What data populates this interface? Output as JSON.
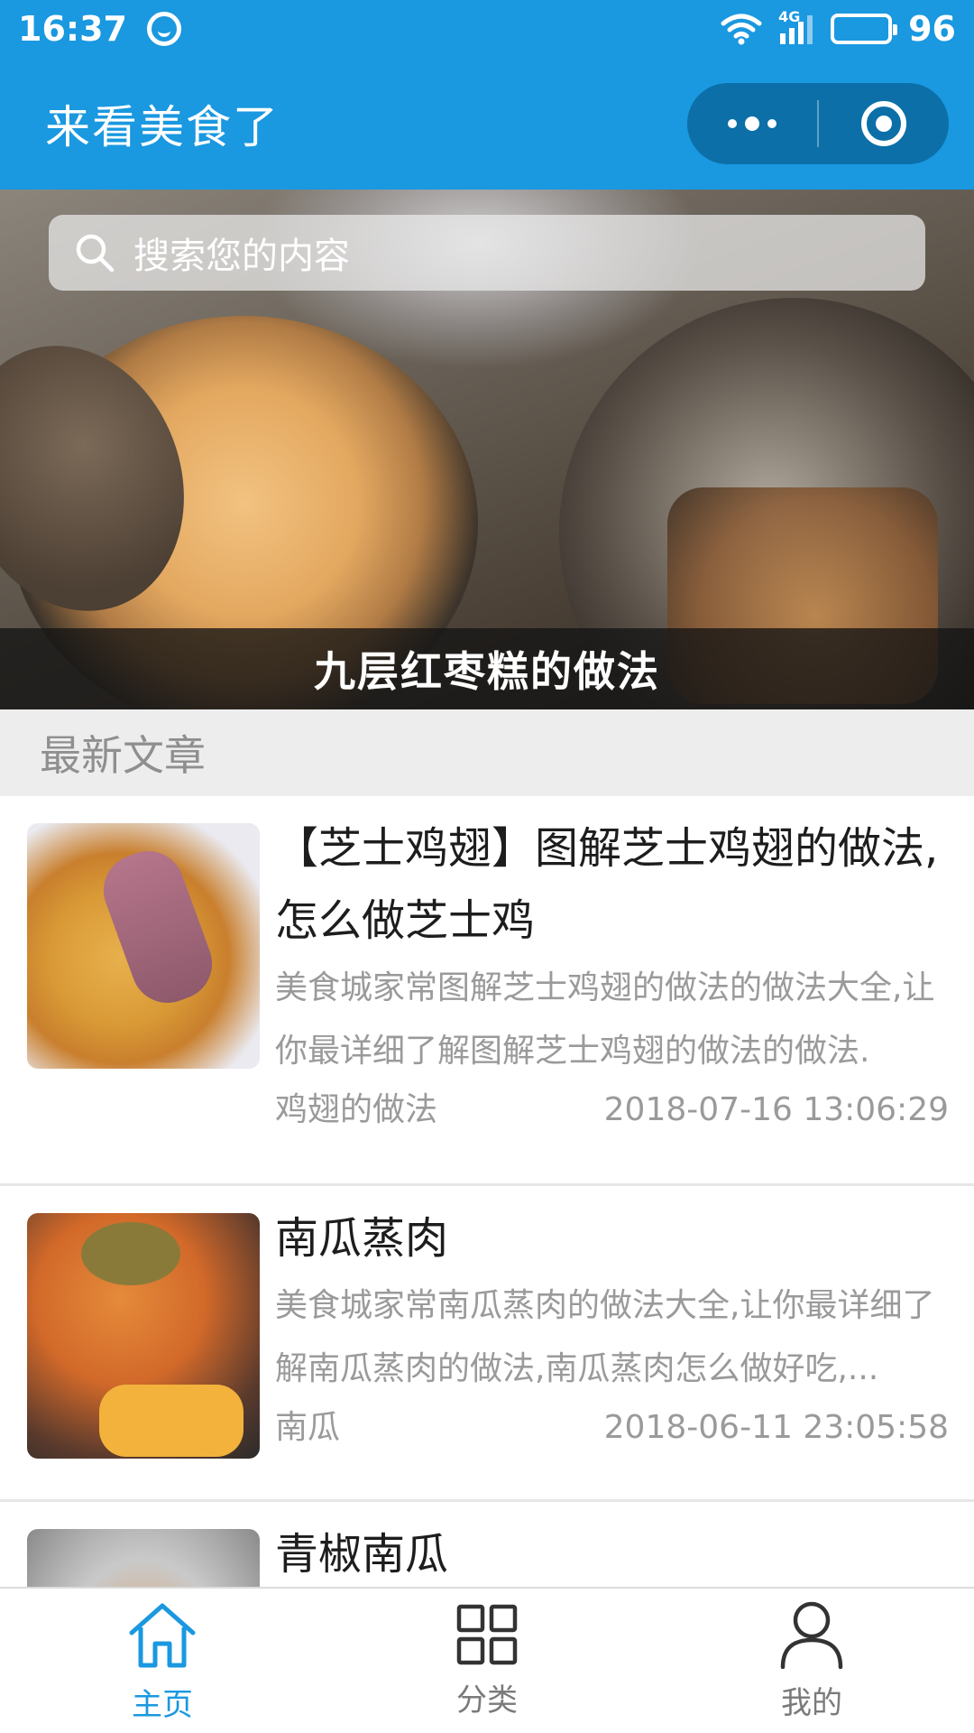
{
  "status_bar": {
    "time": "16:37",
    "network": "4G",
    "battery": "96"
  },
  "header": {
    "title": "来看美食了"
  },
  "search": {
    "placeholder": "搜索您的内容"
  },
  "banner": {
    "caption": "九层红枣糕的做法"
  },
  "section": {
    "title": "最新文章"
  },
  "articles": [
    {
      "title": "【芝士鸡翅】图解芝士鸡翅的做法,怎么做芝士鸡",
      "desc": "美食城家常图解芝士鸡翅的做法的做法大全,让你最详细了解图解芝士鸡翅的做法的做法.",
      "tag": "鸡翅的做法",
      "date": "2018-07-16 13:06:29"
    },
    {
      "title": "南瓜蒸肉",
      "desc": "美食城家常南瓜蒸肉的做法大全,让你最详细了解南瓜蒸肉的做法,南瓜蒸肉怎么做好吃,...",
      "tag": "南瓜",
      "date": "2018-06-11 23:05:58"
    },
    {
      "title": "青椒南瓜",
      "desc": "",
      "tag": "",
      "date": ""
    }
  ],
  "tabbar": {
    "items": [
      {
        "label": "主页",
        "icon": "home-icon",
        "active": true
      },
      {
        "label": "分类",
        "icon": "grid-icon",
        "active": false
      },
      {
        "label": "我的",
        "icon": "person-icon",
        "active": false
      }
    ]
  },
  "colors": {
    "primary": "#1a98e0",
    "capsule": "#0c6fa8",
    "section_bg": "#ededed",
    "muted_text": "#9a9a9a"
  }
}
